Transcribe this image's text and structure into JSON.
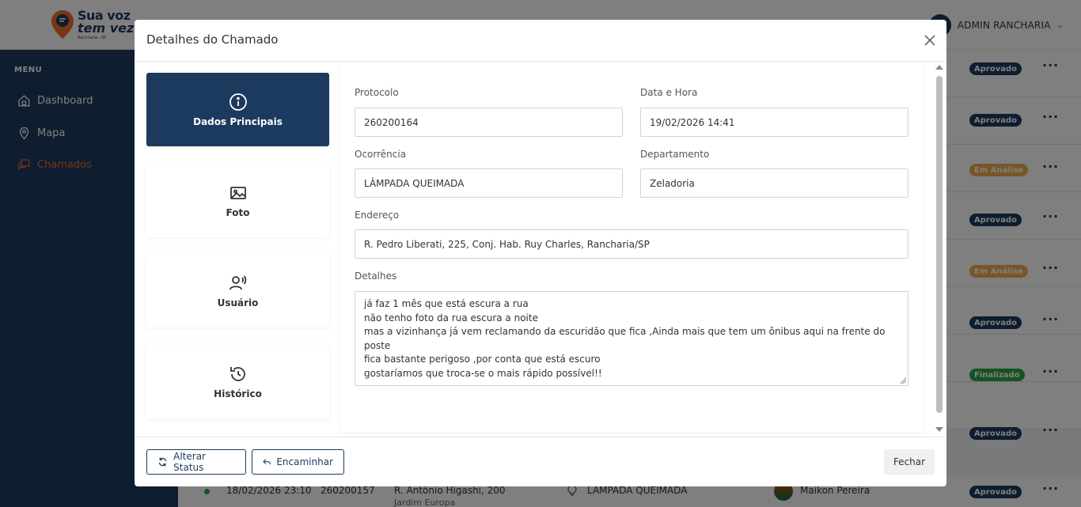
{
  "app": {
    "logo_line1": "Sua voz",
    "logo_line2": "tem vez",
    "logo_line3": "Rancharia - SP",
    "user_name": "ADMIN RANCHARIA"
  },
  "sidebar": {
    "menu_title": "MENU",
    "items": [
      {
        "label": "Dashboard",
        "icon": "home-icon"
      },
      {
        "label": "Mapa",
        "icon": "map-pin-icon"
      },
      {
        "label": "Chamados",
        "icon": "chat-icon"
      }
    ]
  },
  "background_table": {
    "badges": [
      "Aprovado",
      "Aprovado",
      "Em Análise",
      "Aprovado",
      "Em Análise",
      "Aprovado",
      "Finalizado",
      "Aprovado"
    ],
    "last_row": {
      "date": "18/02/2026 23:10",
      "protocol": "260200157",
      "address": "R. Antônio Higashi, 200",
      "neighborhood": "Jardim Europa",
      "occurrence": "LÂMPADA QUEIMADA",
      "user": "Maikon Pereira",
      "status": "Aprovado"
    }
  },
  "modal": {
    "title": "Detalhes do Chamado",
    "tabs": [
      {
        "label": "Dados Principais",
        "icon": "info-icon"
      },
      {
        "label": "Foto",
        "icon": "image-icon"
      },
      {
        "label": "Usuário",
        "icon": "user-voice-icon"
      },
      {
        "label": "Histórico",
        "icon": "history-icon"
      }
    ],
    "fields": {
      "protocolo_label": "Protocolo",
      "protocolo": "260200164",
      "data_hora_label": "Data e Hora",
      "data_hora": "19/02/2026 14:41",
      "ocorrencia_label": "Ocorrência",
      "ocorrencia": "LÂMPADA QUEIMADA",
      "departamento_label": "Departamento",
      "departamento": "Zeladoria",
      "endereco_label": "Endereço",
      "endereco": "R. Pedro Liberati, 225, Conj. Hab. Ruy Charles, Rancharia/SP",
      "detalhes_label": "Detalhes",
      "detalhes_lines": [
        "já faz 1 mês que está escura a rua",
        "não tenho foto da rua escura a noite",
        "mas a vizinhança já vem reclamando da escuridão que fica ,Ainda mais que tem um ônibus aqui na frente do",
        "poste",
        "fica bastante perigoso ,por conta que está escuro",
        "gostaríamos que troca-se o mais rápido possível!!"
      ]
    },
    "footer": {
      "alterar_status": "Alterar Status",
      "encaminhar": "Encaminhar",
      "fechar": "Fechar"
    }
  },
  "colors": {
    "primary": "#1c3a5e",
    "accent": "#ef6c2c",
    "badge_aprovado": "#1c3a5e",
    "badge_analise": "#f0ad4e",
    "badge_finalizado": "#28a745"
  }
}
